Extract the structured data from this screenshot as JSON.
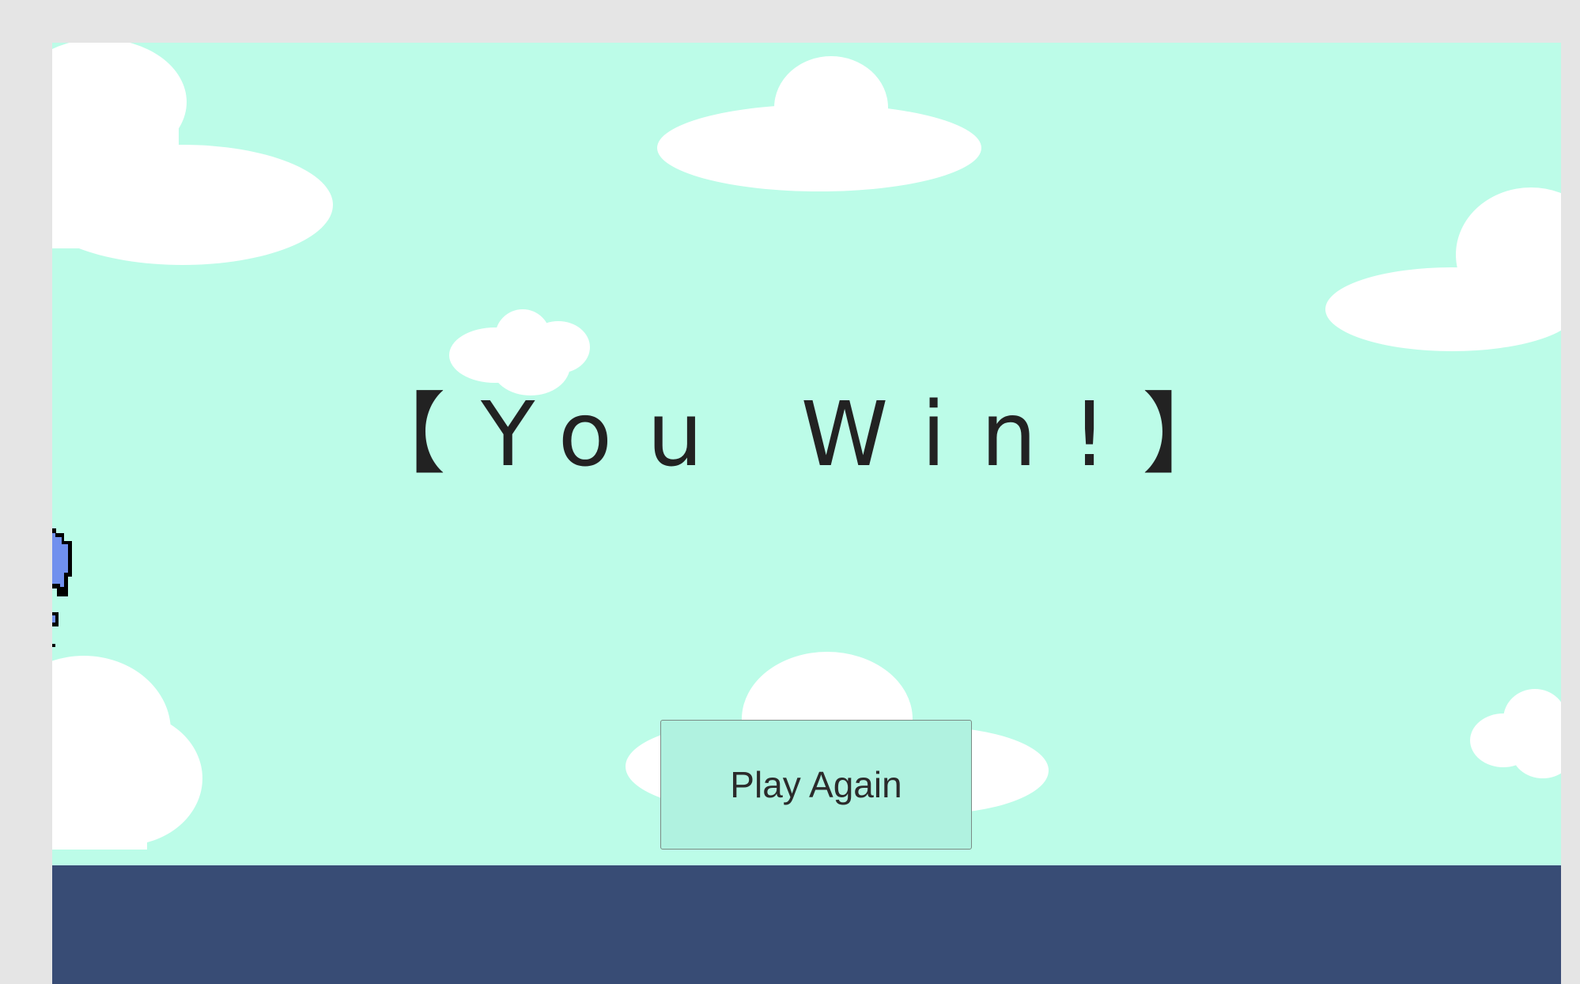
{
  "game": {
    "status_message": "【You Win!】",
    "play_again_label": "Play Again"
  },
  "colors": {
    "sky": "#bcfce8",
    "ground": "#384c75",
    "cloud": "#ffffff",
    "text": "#222222",
    "button_background": "#b0f2e0",
    "player_body": "#7090ee"
  },
  "sprites": {
    "player": "player-character-sprite"
  }
}
